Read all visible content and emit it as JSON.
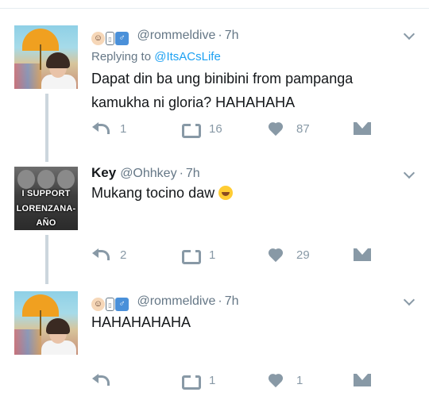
{
  "tweets": [
    {
      "display_name": "",
      "emojis": [
        "person-emoji",
        "unknown-glyph",
        "male-sign"
      ],
      "handle": "@rommeldive",
      "time": "7h",
      "replying_label": "Replying to",
      "replying_to": "@ItsACsLife",
      "text": "Dapat din ba ung binibini from pampanga kamukha ni gloria? HAHAHAHA",
      "reply_count": "1",
      "retweet_count": "16",
      "like_count": "87"
    },
    {
      "display_name": "Key",
      "handle": "@Ohhkey",
      "time": "7h",
      "avatar_text": [
        "I SUPPORT",
        "LORENZANA-",
        "AÑO"
      ],
      "text": "Mukang tocino daw",
      "reply_count": "2",
      "retweet_count": "1",
      "like_count": "29"
    },
    {
      "display_name": "",
      "emojis": [
        "person-emoji",
        "unknown-glyph",
        "male-sign"
      ],
      "handle": "@rommeldive",
      "time": "7h",
      "text": "HAHAHAHAHA",
      "reply_count": "",
      "retweet_count": "1",
      "like_count": "1"
    }
  ],
  "colors": {
    "text": "#14171a",
    "muted": "#657786",
    "icon": "#8899a6",
    "link": "#1da1f2",
    "thread_line": "#ccd6dd"
  }
}
